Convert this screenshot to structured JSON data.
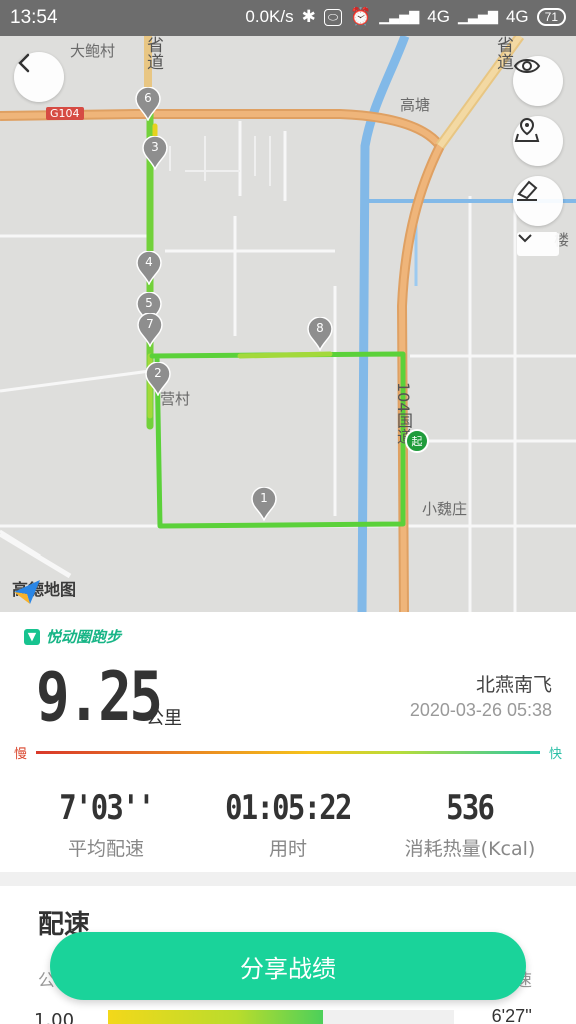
{
  "status_bar": {
    "time": "13:54",
    "net_speed": "0.0K/s",
    "signal1": "4G",
    "signal2": "4G",
    "battery": "71",
    "icons": [
      "bluetooth-icon",
      "hd-icon",
      "alarm-icon",
      "signal-icon",
      "battery-icon"
    ]
  },
  "map": {
    "labels": {
      "village_top": "大鲍村",
      "road_province_top": "省道",
      "road_g104": "G104",
      "gaotang": "高塘",
      "road_province_right": "省道",
      "lou": "楼",
      "ying_village": "营村",
      "road_104": "104国道",
      "xiaowei": "小魏庄",
      "start": "起"
    },
    "markers": [
      "1",
      "2",
      "3",
      "4",
      "5",
      "6",
      "7",
      "8"
    ],
    "logo": "高德地图",
    "controls": [
      "back-icon",
      "eye-icon",
      "map-pin-icon",
      "eraser-icon",
      "chevron-down-icon"
    ]
  },
  "summary": {
    "brand": "悦动圈跑步",
    "distance": "9.25",
    "distance_unit": "公里",
    "user": "北燕南飞",
    "datetime": "2020-03-26 05:38",
    "slow": "慢",
    "fast": "快",
    "avg_pace": "7'03''",
    "avg_pace_label": "平均配速",
    "duration": "01:05:22",
    "duration_label": "用时",
    "calories": "536",
    "calories_label": "消耗热量(Kcal)"
  },
  "pace_section": {
    "title": "配速",
    "col_left": "公",
    "col_right": "速",
    "rows": [
      {
        "km": "1.00",
        "pace": "6'27''",
        "bar_fraction": 0.62
      }
    ]
  },
  "share_button": "分享战绩"
}
